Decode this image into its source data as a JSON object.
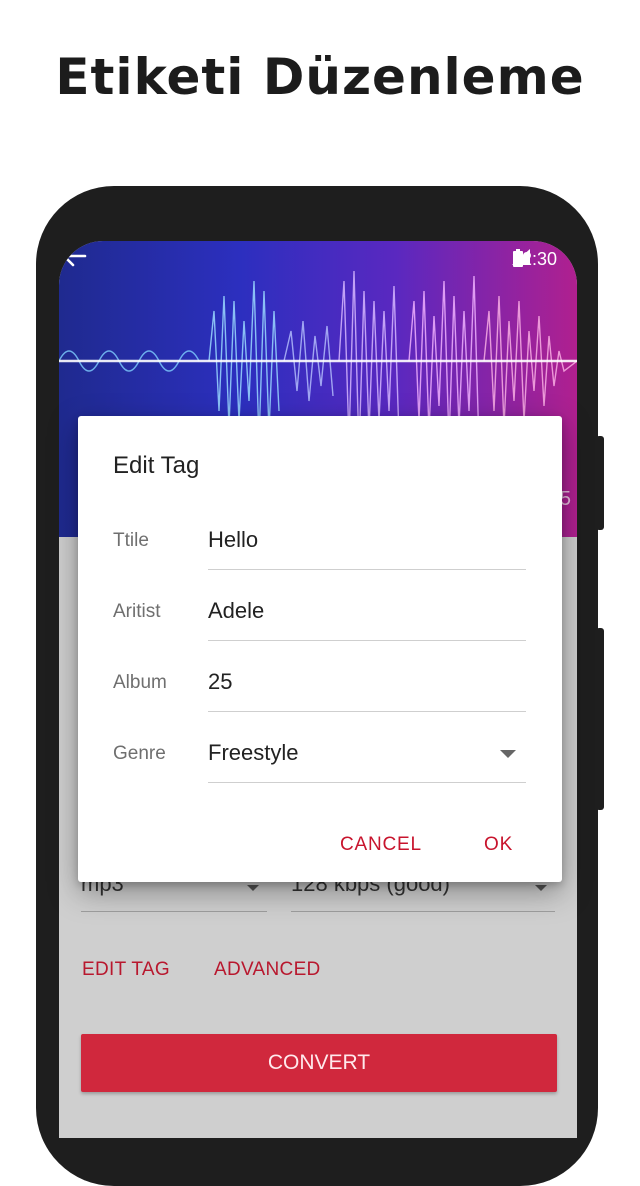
{
  "headline": "Etiketi Düzenleme",
  "status_bar": {
    "time": "12:30",
    "signal_icon": "signal-icon",
    "battery_icon": "battery-icon"
  },
  "app_header": {
    "back_icon": "arrow-left-icon",
    "side_text": "5"
  },
  "background_form": {
    "format_value": "mp3",
    "bitrate_value": "128 kbps (good)",
    "edit_tag_label": "EDIT TAG",
    "advanced_label": "ADVANCED",
    "convert_label": "CONVERT"
  },
  "dialog": {
    "title": "Edit Tag",
    "fields": [
      {
        "label": "Ttile",
        "value": "Hello"
      },
      {
        "label": "Aritist",
        "value": "Adele"
      },
      {
        "label": "Album",
        "value": "25"
      },
      {
        "label": "Genre",
        "value": "Freestyle"
      }
    ],
    "cancel_label": "CANCEL",
    "ok_label": "OK"
  },
  "colors": {
    "accent": "#c8142d",
    "convert_button": "#d0283d"
  }
}
